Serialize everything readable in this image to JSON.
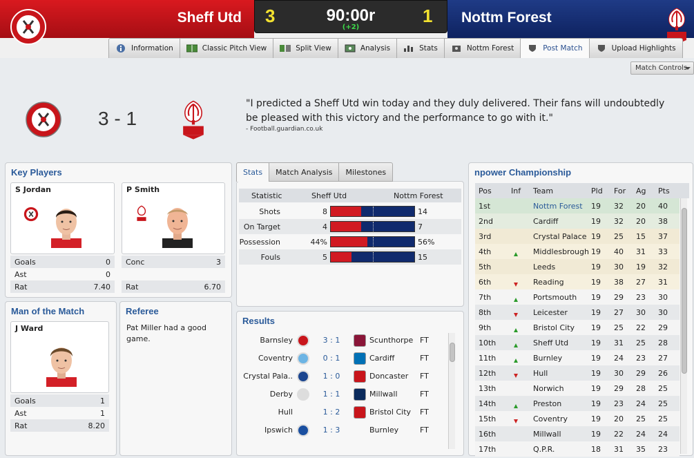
{
  "header": {
    "home_team": "Sheff Utd",
    "away_team": "Nottm Forest",
    "home_score": "3",
    "away_score": "1",
    "clock": "90:00r",
    "added_time": "(+2)"
  },
  "tabs": [
    {
      "label": "Information",
      "icon": "info-icon"
    },
    {
      "label": "Classic Pitch View",
      "icon": "pitch-icon"
    },
    {
      "label": "Split View",
      "icon": "split-view-icon"
    },
    {
      "label": "Analysis",
      "icon": "analysis-icon"
    },
    {
      "label": "Stats",
      "icon": "stats-icon"
    },
    {
      "label": "Nottm Forest",
      "icon": "team-icon"
    },
    {
      "label": "Post Match",
      "icon": "shield-icon",
      "active": true
    },
    {
      "label": "Upload Highlights",
      "icon": "shield-icon"
    }
  ],
  "match_controls": "Match Controls",
  "summary": {
    "score": "3 - 1",
    "quote": "\"I predicted a Sheff Utd win today and they duly delivered. Their fans will undoubtedly be pleased with this victory and the performance to go with it.\"",
    "source": "- Football.guardian.co.uk"
  },
  "key_players": {
    "title": "Key Players",
    "home": {
      "name": "S Jordan",
      "stats": [
        {
          "label": "Goals",
          "value": "0"
        },
        {
          "label": "Ast",
          "value": "0"
        },
        {
          "label": "Rat",
          "value": "7.40"
        }
      ]
    },
    "away": {
      "name": "P Smith",
      "stats": [
        {
          "label": "Conc",
          "value": "3"
        },
        {
          "label": "Rat",
          "value": "6.70"
        }
      ]
    }
  },
  "motm": {
    "title": "Man of the Match",
    "name": "J Ward",
    "stats": [
      {
        "label": "Goals",
        "value": "1"
      },
      {
        "label": "Ast",
        "value": "1"
      },
      {
        "label": "Rat",
        "value": "8.20"
      }
    ]
  },
  "referee": {
    "title": "Referee",
    "text": "Pat Miller had a good game."
  },
  "stats_tabs": [
    "Stats",
    "Match Analysis",
    "Milestones"
  ],
  "stats": {
    "head": {
      "statistic": "Statistic",
      "home": "Sheff Utd",
      "away": "Nottm Forest"
    },
    "rows": [
      {
        "label": "Shots",
        "home": "8",
        "away": "14",
        "home_share": 0.364
      },
      {
        "label": "On Target",
        "home": "4",
        "away": "7",
        "home_share": 0.364
      },
      {
        "label": "Possession",
        "home": "44%",
        "away": "56%",
        "home_share": 0.44
      },
      {
        "label": "Fouls",
        "home": "5",
        "away": "15",
        "home_share": 0.25
      }
    ]
  },
  "results": {
    "title": "Results",
    "rows": [
      {
        "home": "Barnsley",
        "score": "3 : 1",
        "away": "Scunthorpe",
        "status": "FT"
      },
      {
        "home": "Coventry",
        "score": "0 : 1",
        "away": "Cardiff",
        "status": "FT"
      },
      {
        "home": "Crystal Pala..",
        "score": "1 : 0",
        "away": "Doncaster",
        "status": "FT"
      },
      {
        "home": "Derby",
        "score": "1 : 1",
        "away": "Millwall",
        "status": "FT"
      },
      {
        "home": "Hull",
        "score": "1 : 2",
        "away": "Bristol City",
        "status": "FT"
      },
      {
        "home": "Ipswich",
        "score": "1 : 3",
        "away": "Burnley",
        "status": "FT"
      }
    ]
  },
  "league": {
    "title": "npower Championship",
    "columns": [
      "Pos",
      "Inf",
      "Team",
      "Pld",
      "For",
      "Ag",
      "Pts"
    ],
    "rows": [
      {
        "pos": "1st",
        "inf": "",
        "team": "Nottm Forest",
        "pld": "19",
        "for": "32",
        "ag": "20",
        "pts": "40"
      },
      {
        "pos": "2nd",
        "inf": "",
        "team": "Cardiff",
        "pld": "19",
        "for": "32",
        "ag": "20",
        "pts": "38"
      },
      {
        "pos": "3rd",
        "inf": "",
        "team": "Crystal Palace",
        "pld": "19",
        "for": "25",
        "ag": "15",
        "pts": "37"
      },
      {
        "pos": "4th",
        "inf": "up",
        "team": "Middlesbrough",
        "pld": "19",
        "for": "40",
        "ag": "31",
        "pts": "33"
      },
      {
        "pos": "5th",
        "inf": "",
        "team": "Leeds",
        "pld": "19",
        "for": "30",
        "ag": "19",
        "pts": "32"
      },
      {
        "pos": "6th",
        "inf": "down",
        "team": "Reading",
        "pld": "19",
        "for": "38",
        "ag": "27",
        "pts": "31"
      },
      {
        "pos": "7th",
        "inf": "up",
        "team": "Portsmouth",
        "pld": "19",
        "for": "29",
        "ag": "23",
        "pts": "30"
      },
      {
        "pos": "8th",
        "inf": "down",
        "team": "Leicester",
        "pld": "19",
        "for": "27",
        "ag": "30",
        "pts": "30"
      },
      {
        "pos": "9th",
        "inf": "up",
        "team": "Bristol City",
        "pld": "19",
        "for": "25",
        "ag": "22",
        "pts": "29"
      },
      {
        "pos": "10th",
        "inf": "up",
        "team": "Sheff Utd",
        "pld": "19",
        "for": "31",
        "ag": "25",
        "pts": "28"
      },
      {
        "pos": "11th",
        "inf": "up",
        "team": "Burnley",
        "pld": "19",
        "for": "24",
        "ag": "23",
        "pts": "27"
      },
      {
        "pos": "12th",
        "inf": "down",
        "team": "Hull",
        "pld": "19",
        "for": "30",
        "ag": "29",
        "pts": "26"
      },
      {
        "pos": "13th",
        "inf": "",
        "team": "Norwich",
        "pld": "19",
        "for": "29",
        "ag": "28",
        "pts": "25"
      },
      {
        "pos": "14th",
        "inf": "up",
        "team": "Preston",
        "pld": "19",
        "for": "23",
        "ag": "24",
        "pts": "25"
      },
      {
        "pos": "15th",
        "inf": "down",
        "team": "Coventry",
        "pld": "19",
        "for": "20",
        "ag": "25",
        "pts": "25"
      },
      {
        "pos": "16th",
        "inf": "",
        "team": "Millwall",
        "pld": "19",
        "for": "22",
        "ag": "24",
        "pts": "24"
      },
      {
        "pos": "17th",
        "inf": "",
        "team": "Q.P.R.",
        "pld": "18",
        "for": "31",
        "ag": "35",
        "pts": "23"
      }
    ]
  },
  "colors": {
    "home_red": "#d11a22",
    "away_navy": "#102a6d",
    "accent_blue": "#2a5a99",
    "score_yellow": "#f3e230"
  }
}
